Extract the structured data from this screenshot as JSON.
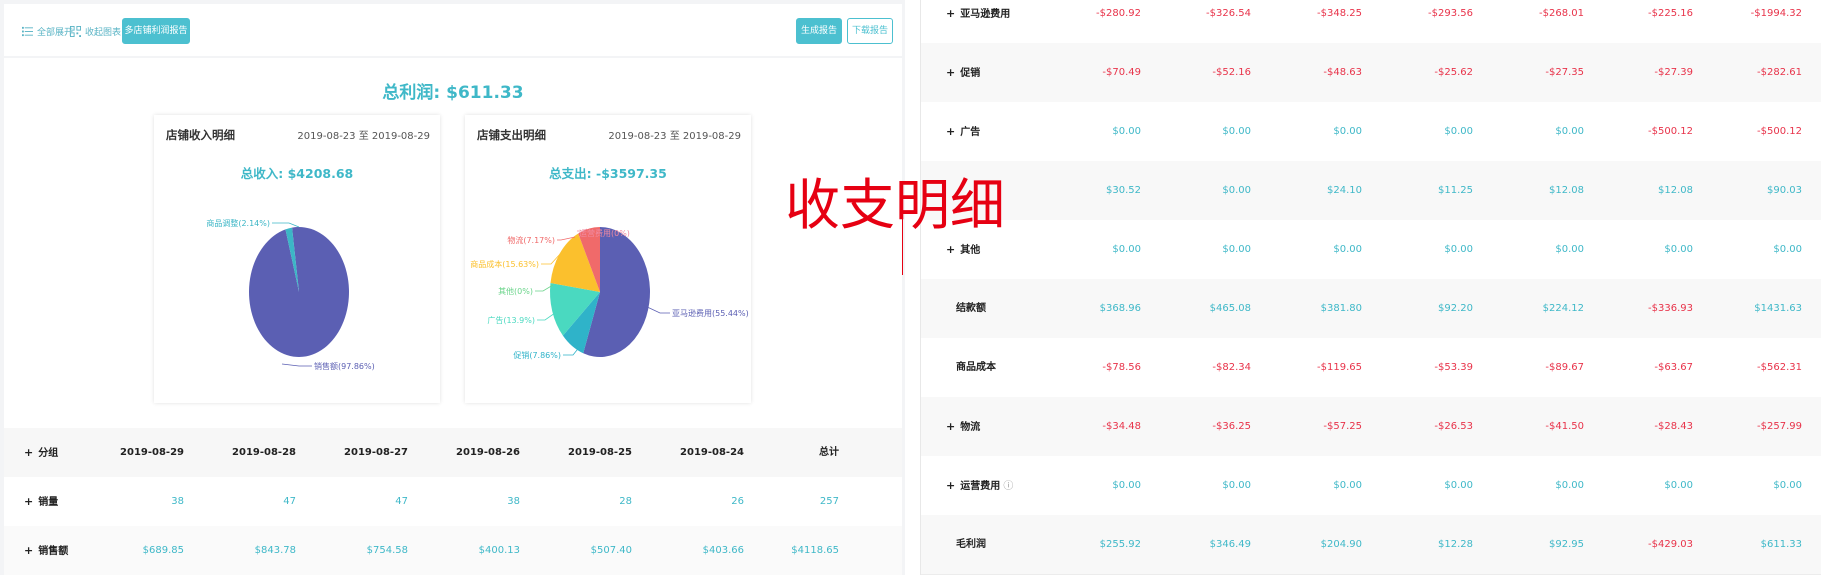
{
  "toolbar": {
    "expand_all": "全部展开",
    "collapse_chart": "收起图表",
    "multi_store": "多店铺利润报告",
    "generate": "生成报告",
    "download": "下载报告"
  },
  "summary": {
    "total_profit": "总利润: $611.33"
  },
  "income_card": {
    "title": "店铺收入明细",
    "date_range": "2019-08-23 至 2019-08-29",
    "total": "总收入: $4208.68",
    "chart_data": {
      "type": "pie",
      "title": "",
      "slices": [
        {
          "label": "销售额(97.86%)",
          "value": 97.86,
          "color": "#5b5fb3"
        },
        {
          "label": "商品调整(2.14%)",
          "value": 2.14,
          "color": "#3cb6c6"
        }
      ]
    }
  },
  "expense_card": {
    "title": "店铺支出明细",
    "date_range": "2019-08-23 至 2019-08-29",
    "total": "总支出: -$3597.35",
    "chart_data": {
      "type": "pie",
      "title": "",
      "slices": [
        {
          "label": "亚马逊费用(55.44%)",
          "value": 55.44,
          "color": "#5b5fb3"
        },
        {
          "label": "促销(7.86%)",
          "value": 7.86,
          "color": "#2fb3c9"
        },
        {
          "label": "广告(13.9%)",
          "value": 13.9,
          "color": "#4ad9c0"
        },
        {
          "label": "其他(0%)",
          "value": 0,
          "color": "#6ad48a"
        },
        {
          "label": "商品成本(15.63%)",
          "value": 15.63,
          "color": "#fbc02d"
        },
        {
          "label": "物流(7.17%)",
          "value": 7.17,
          "color": "#f06a6a"
        },
        {
          "label": "运营费用(0%)",
          "value": 0,
          "color": "#f08aa0"
        }
      ]
    }
  },
  "left_table": {
    "headers": [
      "分组",
      "2019-08-29",
      "2019-08-28",
      "2019-08-27",
      "2019-08-26",
      "2019-08-25",
      "2019-08-24",
      "总计"
    ],
    "rows": [
      {
        "name": "销量",
        "values": [
          "38",
          "47",
          "47",
          "38",
          "28",
          "26",
          "257"
        ]
      },
      {
        "name": "销售额",
        "values": [
          "$689.85",
          "$843.78",
          "$754.58",
          "$400.13",
          "$507.40",
          "$403.66",
          "$4118.65"
        ]
      }
    ]
  },
  "overlay_title": "收支明细",
  "right_table": {
    "rows": [
      {
        "name": "亚马逊费用",
        "plus": true,
        "values": [
          "-$280.92",
          "-$326.54",
          "-$348.25",
          "-$293.56",
          "-$268.01",
          "-$225.16",
          "-$1994.32"
        ]
      },
      {
        "name": "促销",
        "plus": true,
        "values": [
          "-$70.49",
          "-$52.16",
          "-$48.63",
          "-$25.62",
          "-$27.35",
          "-$27.39",
          "-$282.61"
        ]
      },
      {
        "name": "广告",
        "plus": true,
        "values": [
          "$0.00",
          "$0.00",
          "$0.00",
          "$0.00",
          "$0.00",
          "-$500.12",
          "-$500.12"
        ]
      },
      {
        "name": "",
        "plus": false,
        "values": [
          "$30.52",
          "$0.00",
          "$24.10",
          "$11.25",
          "$12.08",
          "$12.08",
          "$90.03"
        ]
      },
      {
        "name": "其他",
        "plus": true,
        "values": [
          "$0.00",
          "$0.00",
          "$0.00",
          "$0.00",
          "$0.00",
          "$0.00",
          "$0.00"
        ]
      },
      {
        "name": "结款额",
        "plus": false,
        "values": [
          "$368.96",
          "$465.08",
          "$381.80",
          "$92.20",
          "$224.12",
          "-$336.93",
          "$1431.63"
        ]
      },
      {
        "name": "商品成本",
        "plus": false,
        "values": [
          "-$78.56",
          "-$82.34",
          "-$119.65",
          "-$53.39",
          "-$89.67",
          "-$63.67",
          "-$562.31"
        ]
      },
      {
        "name": "物流",
        "plus": true,
        "values": [
          "-$34.48",
          "-$36.25",
          "-$57.25",
          "-$26.53",
          "-$41.50",
          "-$28.43",
          "-$257.99"
        ]
      },
      {
        "name": "运营费用",
        "plus": true,
        "help": true,
        "values": [
          "$0.00",
          "$0.00",
          "$0.00",
          "$0.00",
          "$0.00",
          "$0.00",
          "$0.00"
        ]
      },
      {
        "name": "毛利润",
        "plus": false,
        "values": [
          "$255.92",
          "$346.49",
          "$204.90",
          "$12.28",
          "$92.95",
          "-$429.03",
          "$611.33"
        ]
      }
    ]
  },
  "colors": {
    "accent": "#4cc0d0",
    "positive": "#3fb8c8",
    "negative": "#e8334a",
    "overlay": "#e60012"
  }
}
